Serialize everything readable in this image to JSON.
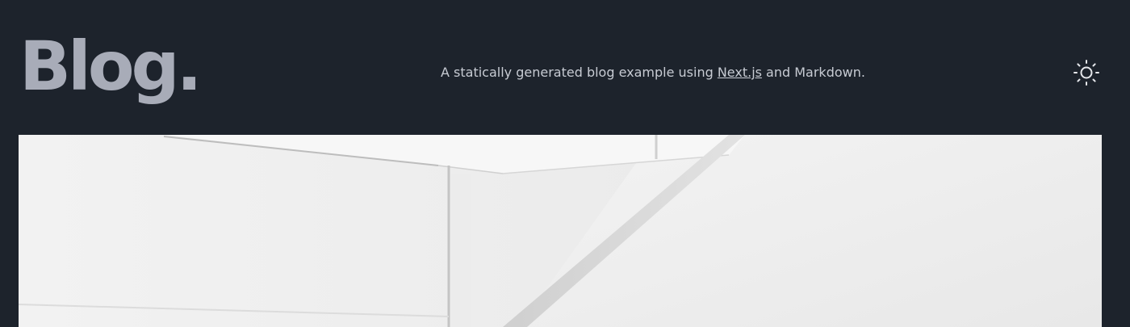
{
  "header": {
    "logo_text": "Blog.",
    "tagline_prefix": "A statically generated blog example using ",
    "tagline_link": "Next.js",
    "tagline_suffix": " and Markdown.",
    "theme_icon": "sun-icon"
  },
  "hero": {
    "image": "architecture-photo",
    "colors": {
      "background": "#1d232c",
      "logo": "#a8acb8",
      "text": "#c7cbd3"
    }
  }
}
